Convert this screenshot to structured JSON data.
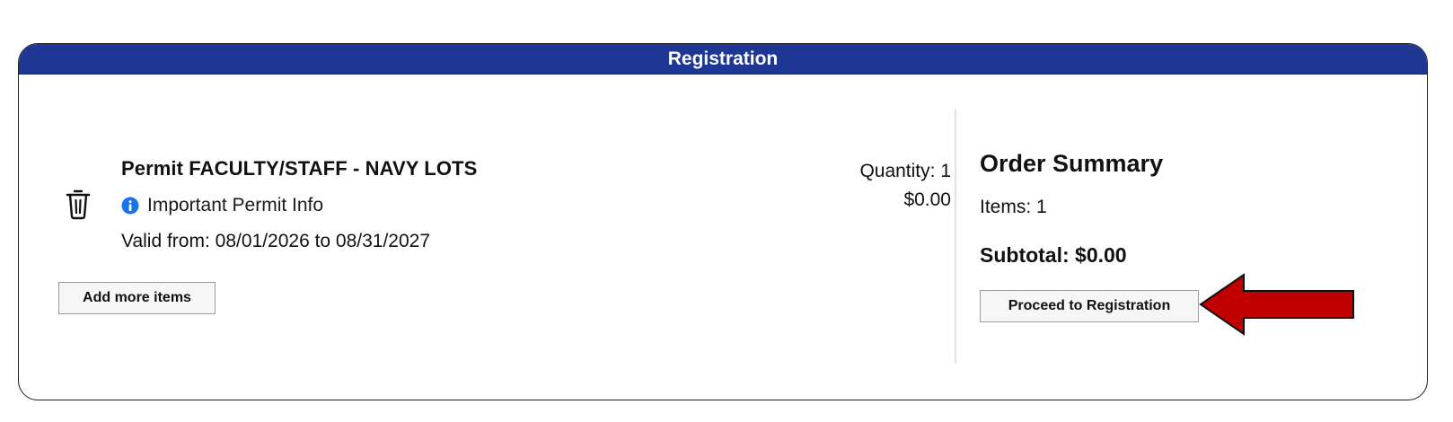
{
  "header": {
    "title": "Registration"
  },
  "cart_item": {
    "title": "Permit FACULTY/STAFF - NAVY LOTS",
    "info_link": "Important Permit Info",
    "valid": "Valid from: 08/01/2026 to 08/31/2027",
    "quantity": "Quantity: 1",
    "price": "$0.00",
    "delete_icon": "trash-icon",
    "info_icon": "info-circle-icon"
  },
  "actions": {
    "add_more": "Add more items"
  },
  "summary": {
    "title": "Order Summary",
    "items": "Items: 1",
    "subtotal": "Subtotal: $0.00",
    "proceed": "Proceed to Registration",
    "annotation_icon": "red-arrow-icon"
  },
  "colors": {
    "header_bg": "#1e3694",
    "arrow": "#c00000",
    "info_icon": "#1a73e8"
  }
}
